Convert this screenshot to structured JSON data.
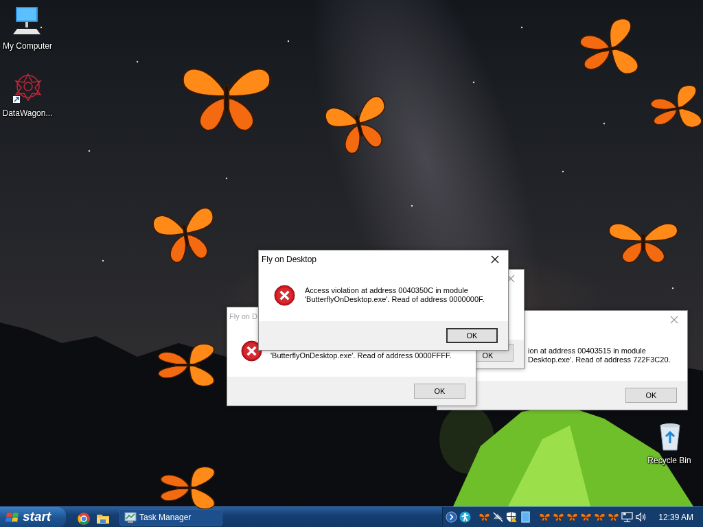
{
  "desktop_icons": [
    {
      "label": "My Computer",
      "kind": "computer"
    },
    {
      "label": "DataWagon...",
      "kind": "shortcut"
    },
    {
      "label": "Recycle Bin",
      "kind": "recycle"
    }
  ],
  "dialogs": [
    {
      "title": "Fly on Desktop",
      "active": true,
      "message": [
        "Access violation at address 0040350C in module",
        "'ButterflyOnDesktop.exe'. Read of address 0000000F."
      ],
      "button": "OK"
    },
    {
      "title": "Fly on D",
      "active": false,
      "message": [
        "'ButterflyOnDesktop.exe'. Read of address 0000FFFF."
      ],
      "button": "OK"
    },
    {
      "active": false,
      "button": "OK"
    },
    {
      "active": false,
      "message": [
        "ion at address 00403515 in module",
        "Desktop.exe'. Read of address 722F3C20."
      ],
      "button": "OK"
    }
  ],
  "taskbar": {
    "start": "start",
    "tasks": [
      {
        "label": "Task Manager"
      }
    ],
    "clock": "12:39 AM"
  }
}
